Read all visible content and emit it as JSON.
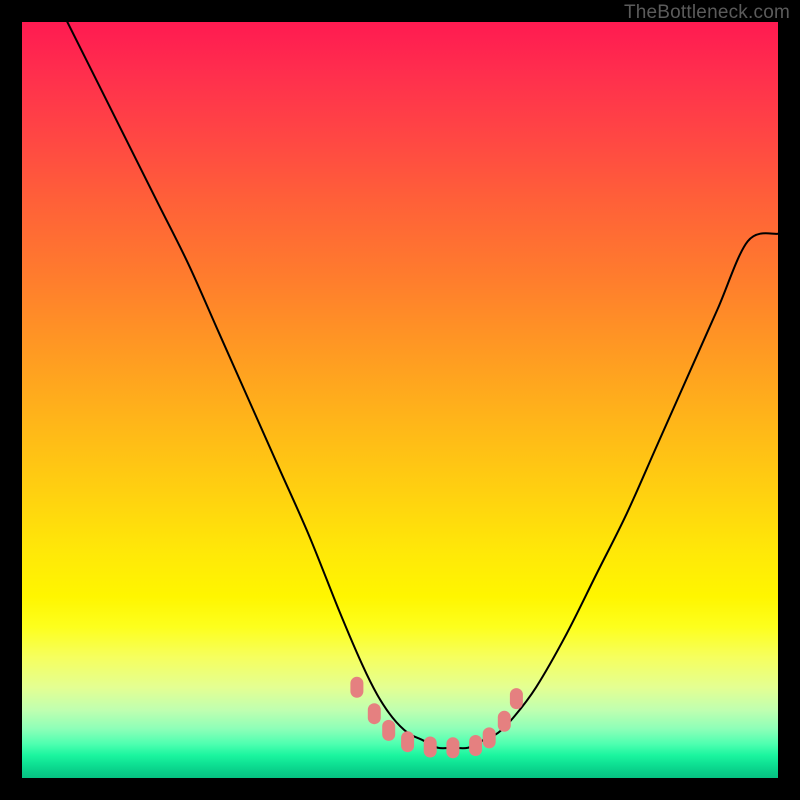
{
  "watermark": "TheBottleneck.com",
  "colors": {
    "background": "#000000",
    "curve_stroke": "#000000",
    "marker_fill": "#e58080",
    "marker_stroke": "#d96f6f",
    "watermark": "#5b5b5b"
  },
  "chart_data": {
    "type": "line",
    "title": "",
    "xlabel": "",
    "ylabel": "",
    "xlim": [
      0,
      100
    ],
    "ylim": [
      0,
      100
    ],
    "grid": false,
    "legend": false,
    "note": "Values are estimated from pixel positions; no axis ticks shown. y=0 is bottom (green), y=100 is top (red).",
    "series": [
      {
        "name": "curve",
        "x": [
          6,
          10,
          14,
          18,
          22,
          26,
          30,
          34,
          38,
          42,
          45,
          47,
          49,
          51,
          53,
          55,
          57,
          59,
          61,
          63,
          65,
          68,
          72,
          76,
          80,
          84,
          88,
          92,
          96,
          100
        ],
        "y": [
          100,
          92,
          84,
          76,
          68,
          59,
          50,
          41,
          32,
          22,
          15,
          11,
          8,
          6,
          5,
          4,
          4,
          4,
          5,
          6,
          8,
          12,
          19,
          27,
          35,
          44,
          53,
          62,
          71,
          72
        ]
      }
    ],
    "markers": {
      "name": "highlight-points",
      "shape": "rounded-rect",
      "x": [
        44.3,
        46.6,
        48.5,
        51.0,
        54.0,
        57.0,
        60.0,
        61.8,
        63.8,
        65.4
      ],
      "y": [
        12.0,
        8.5,
        6.3,
        4.8,
        4.1,
        4.0,
        4.3,
        5.3,
        7.5,
        10.5
      ]
    }
  }
}
